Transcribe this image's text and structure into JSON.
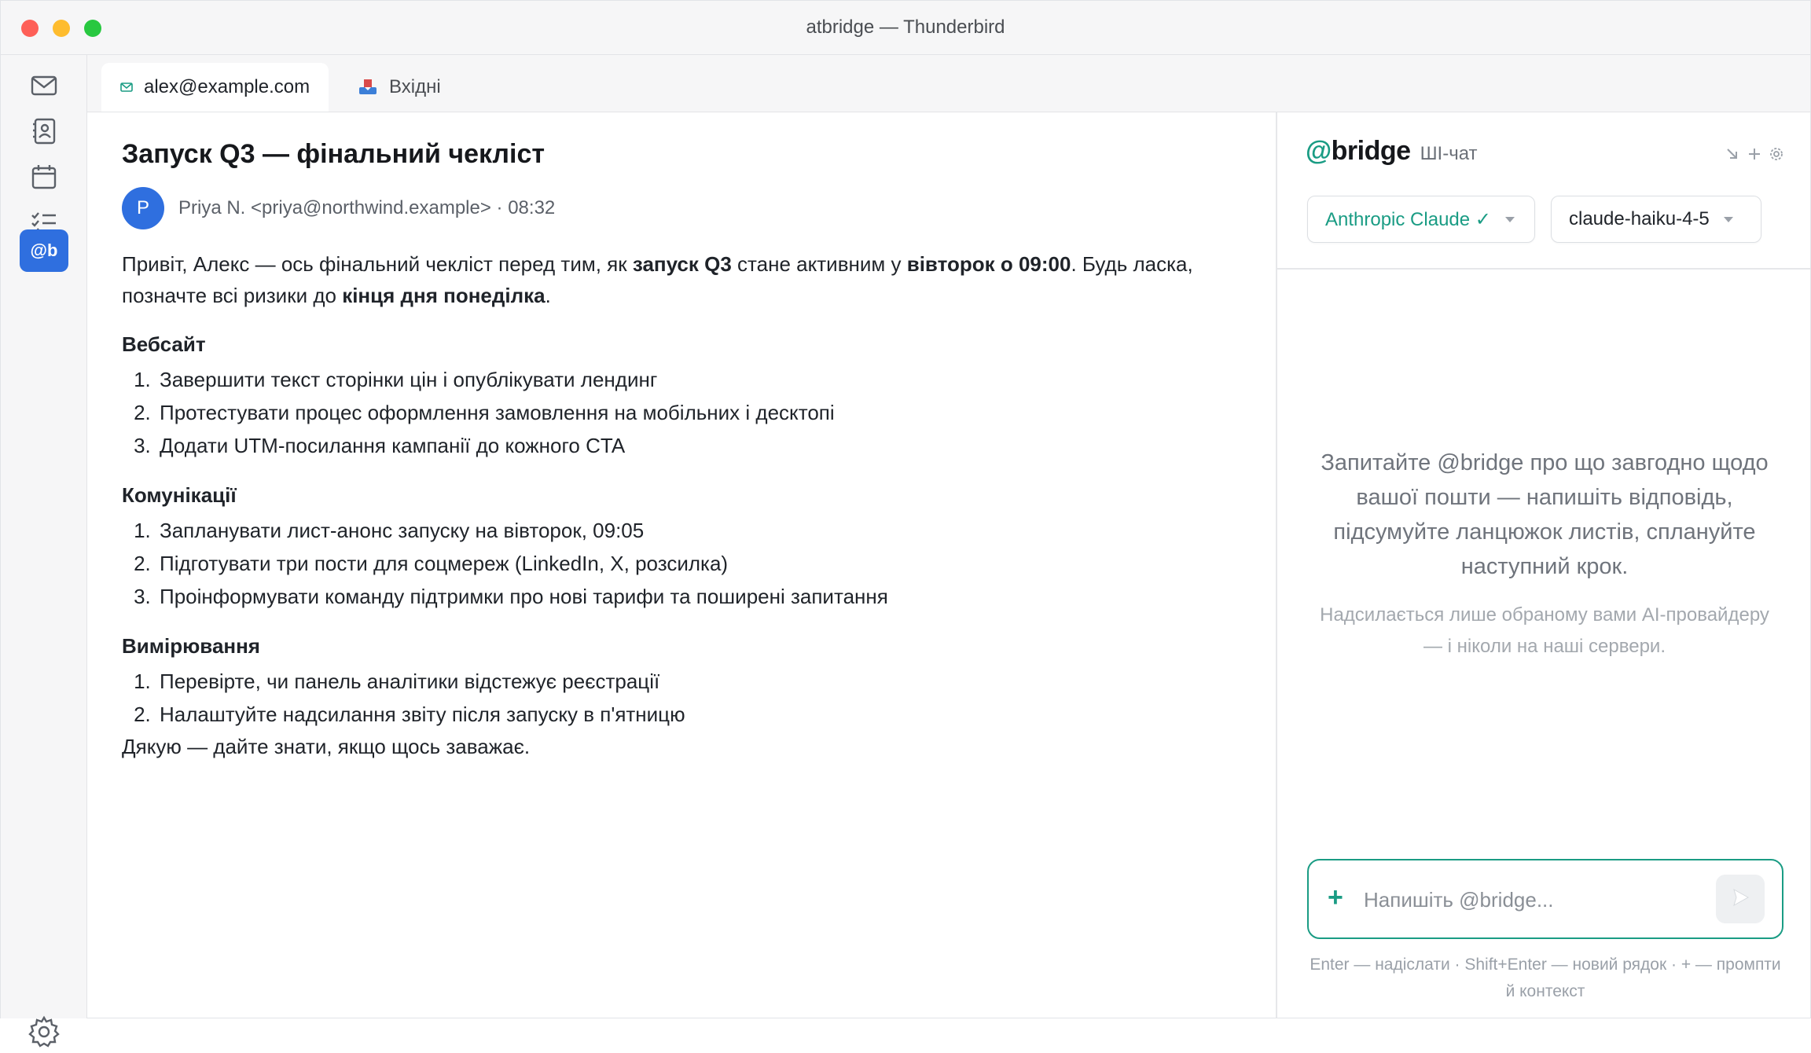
{
  "window": {
    "title": "atbridge — Thunderbird"
  },
  "rail": {
    "items": [
      "mail-icon",
      "address-book-icon",
      "calendar-icon",
      "tasks-icon",
      "atbridge-icon"
    ],
    "active_label": "@b",
    "settings_icon": "gear-icon"
  },
  "tabs": [
    {
      "label": "alex@example.com",
      "icon": "mail-small-icon",
      "active": true
    },
    {
      "label": "Вхідні",
      "icon": "inbox-icon",
      "active": false
    }
  ],
  "message": {
    "subject": "Запуск Q3 — фінальний чекліст",
    "avatar_letter": "P",
    "sender": "Priya N. <priya@northwind.example> · 08:32",
    "intro_1": "Привіт, Алекс — ось фінальний чекліст перед тим, як ",
    "intro_b1": "запуск Q3",
    "intro_2": " стане активним у ",
    "intro_b2": "вівторок о 09:00",
    "intro_3": ". Будь ласка, позначте всі ризики до ",
    "intro_b3": "кінця дня понеділка",
    "intro_4": ".",
    "sections": [
      {
        "heading": "Вебсайт",
        "items": [
          "Завершити текст сторінки цін і опублікувати лендинг",
          "Протестувати процес оформлення замовлення на мобільних і десктопі",
          "Додати UTM-посилання кампанії до кожного CTA"
        ]
      },
      {
        "heading": "Комунікації",
        "items": [
          "Запланувати лист-анонс запуску на вівторок, 09:05",
          "Підготувати три пости для соцмереж (LinkedIn, X, розсилка)",
          "Проінформувати команду підтримки про нові тарифи та поширені запитання"
        ]
      },
      {
        "heading": "Вимірювання",
        "items": [
          "Перевірте, чи панель аналітики відстежує реєстрації",
          "Налаштуйте надсилання звіту після запуску в п'ятницю"
        ]
      }
    ],
    "sign_off": "Дякую — дайте знати, якщо щось заважає."
  },
  "chat": {
    "brand_at": "@",
    "brand_name": "bridge",
    "subtitle": "ШІ-чат",
    "provider": "Anthropic Claude ✓",
    "model": "claude-haiku-4-5",
    "empty_main": "Запитайте @bridge про що завгодно щодо вашої пошти — напишіть відповідь, підсумуйте ланцюжок листів, сплануйте наступний крок.",
    "empty_note": "Надсилається лише обраному вами AI-провайдеру — і ніколи на наші сервери.",
    "plus": "+",
    "input_placeholder": "Напишіть @bridge...",
    "hint": "Enter — надіслати · Shift+Enter — новий рядок · + — промпти й контекст",
    "accent": "#1a9c84"
  }
}
